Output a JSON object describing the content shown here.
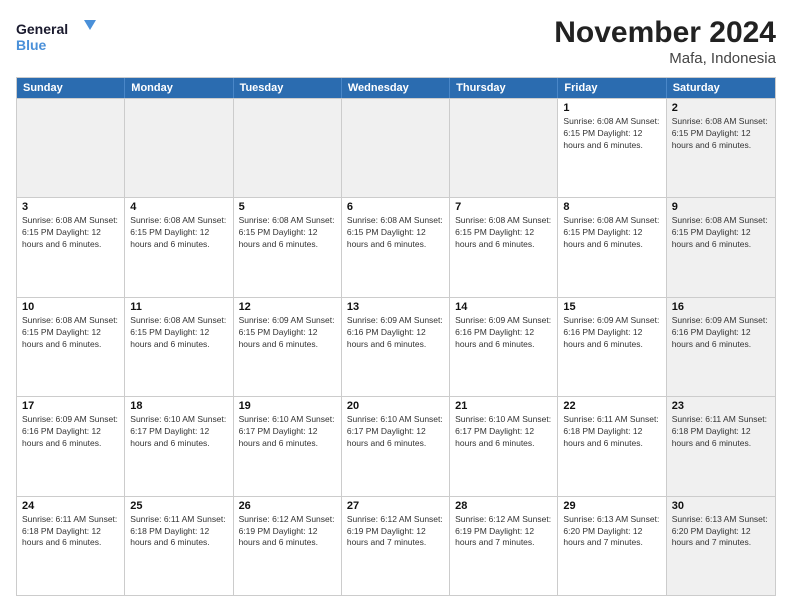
{
  "logo": {
    "line1": "General",
    "line2": "Blue"
  },
  "title": "November 2024",
  "location": "Mafa, Indonesia",
  "header_days": [
    "Sunday",
    "Monday",
    "Tuesday",
    "Wednesday",
    "Thursday",
    "Friday",
    "Saturday"
  ],
  "rows": [
    [
      {
        "day": "",
        "info": "",
        "shaded": true
      },
      {
        "day": "",
        "info": "",
        "shaded": true
      },
      {
        "day": "",
        "info": "",
        "shaded": true
      },
      {
        "day": "",
        "info": "",
        "shaded": true
      },
      {
        "day": "",
        "info": "",
        "shaded": true
      },
      {
        "day": "1",
        "info": "Sunrise: 6:08 AM\nSunset: 6:15 PM\nDaylight: 12 hours\nand 6 minutes.",
        "shaded": false
      },
      {
        "day": "2",
        "info": "Sunrise: 6:08 AM\nSunset: 6:15 PM\nDaylight: 12 hours\nand 6 minutes.",
        "shaded": true
      }
    ],
    [
      {
        "day": "3",
        "info": "Sunrise: 6:08 AM\nSunset: 6:15 PM\nDaylight: 12 hours\nand 6 minutes.",
        "shaded": false
      },
      {
        "day": "4",
        "info": "Sunrise: 6:08 AM\nSunset: 6:15 PM\nDaylight: 12 hours\nand 6 minutes.",
        "shaded": false
      },
      {
        "day": "5",
        "info": "Sunrise: 6:08 AM\nSunset: 6:15 PM\nDaylight: 12 hours\nand 6 minutes.",
        "shaded": false
      },
      {
        "day": "6",
        "info": "Sunrise: 6:08 AM\nSunset: 6:15 PM\nDaylight: 12 hours\nand 6 minutes.",
        "shaded": false
      },
      {
        "day": "7",
        "info": "Sunrise: 6:08 AM\nSunset: 6:15 PM\nDaylight: 12 hours\nand 6 minutes.",
        "shaded": false
      },
      {
        "day": "8",
        "info": "Sunrise: 6:08 AM\nSunset: 6:15 PM\nDaylight: 12 hours\nand 6 minutes.",
        "shaded": false
      },
      {
        "day": "9",
        "info": "Sunrise: 6:08 AM\nSunset: 6:15 PM\nDaylight: 12 hours\nand 6 minutes.",
        "shaded": true
      }
    ],
    [
      {
        "day": "10",
        "info": "Sunrise: 6:08 AM\nSunset: 6:15 PM\nDaylight: 12 hours\nand 6 minutes.",
        "shaded": false
      },
      {
        "day": "11",
        "info": "Sunrise: 6:08 AM\nSunset: 6:15 PM\nDaylight: 12 hours\nand 6 minutes.",
        "shaded": false
      },
      {
        "day": "12",
        "info": "Sunrise: 6:09 AM\nSunset: 6:15 PM\nDaylight: 12 hours\nand 6 minutes.",
        "shaded": false
      },
      {
        "day": "13",
        "info": "Sunrise: 6:09 AM\nSunset: 6:16 PM\nDaylight: 12 hours\nand 6 minutes.",
        "shaded": false
      },
      {
        "day": "14",
        "info": "Sunrise: 6:09 AM\nSunset: 6:16 PM\nDaylight: 12 hours\nand 6 minutes.",
        "shaded": false
      },
      {
        "day": "15",
        "info": "Sunrise: 6:09 AM\nSunset: 6:16 PM\nDaylight: 12 hours\nand 6 minutes.",
        "shaded": false
      },
      {
        "day": "16",
        "info": "Sunrise: 6:09 AM\nSunset: 6:16 PM\nDaylight: 12 hours\nand 6 minutes.",
        "shaded": true
      }
    ],
    [
      {
        "day": "17",
        "info": "Sunrise: 6:09 AM\nSunset: 6:16 PM\nDaylight: 12 hours\nand 6 minutes.",
        "shaded": false
      },
      {
        "day": "18",
        "info": "Sunrise: 6:10 AM\nSunset: 6:17 PM\nDaylight: 12 hours\nand 6 minutes.",
        "shaded": false
      },
      {
        "day": "19",
        "info": "Sunrise: 6:10 AM\nSunset: 6:17 PM\nDaylight: 12 hours\nand 6 minutes.",
        "shaded": false
      },
      {
        "day": "20",
        "info": "Sunrise: 6:10 AM\nSunset: 6:17 PM\nDaylight: 12 hours\nand 6 minutes.",
        "shaded": false
      },
      {
        "day": "21",
        "info": "Sunrise: 6:10 AM\nSunset: 6:17 PM\nDaylight: 12 hours\nand 6 minutes.",
        "shaded": false
      },
      {
        "day": "22",
        "info": "Sunrise: 6:11 AM\nSunset: 6:18 PM\nDaylight: 12 hours\nand 6 minutes.",
        "shaded": false
      },
      {
        "day": "23",
        "info": "Sunrise: 6:11 AM\nSunset: 6:18 PM\nDaylight: 12 hours\nand 6 minutes.",
        "shaded": true
      }
    ],
    [
      {
        "day": "24",
        "info": "Sunrise: 6:11 AM\nSunset: 6:18 PM\nDaylight: 12 hours\nand 6 minutes.",
        "shaded": false
      },
      {
        "day": "25",
        "info": "Sunrise: 6:11 AM\nSunset: 6:18 PM\nDaylight: 12 hours\nand 6 minutes.",
        "shaded": false
      },
      {
        "day": "26",
        "info": "Sunrise: 6:12 AM\nSunset: 6:19 PM\nDaylight: 12 hours\nand 6 minutes.",
        "shaded": false
      },
      {
        "day": "27",
        "info": "Sunrise: 6:12 AM\nSunset: 6:19 PM\nDaylight: 12 hours\nand 7 minutes.",
        "shaded": false
      },
      {
        "day": "28",
        "info": "Sunrise: 6:12 AM\nSunset: 6:19 PM\nDaylight: 12 hours\nand 7 minutes.",
        "shaded": false
      },
      {
        "day": "29",
        "info": "Sunrise: 6:13 AM\nSunset: 6:20 PM\nDaylight: 12 hours\nand 7 minutes.",
        "shaded": false
      },
      {
        "day": "30",
        "info": "Sunrise: 6:13 AM\nSunset: 6:20 PM\nDaylight: 12 hours\nand 7 minutes.",
        "shaded": true
      }
    ]
  ]
}
